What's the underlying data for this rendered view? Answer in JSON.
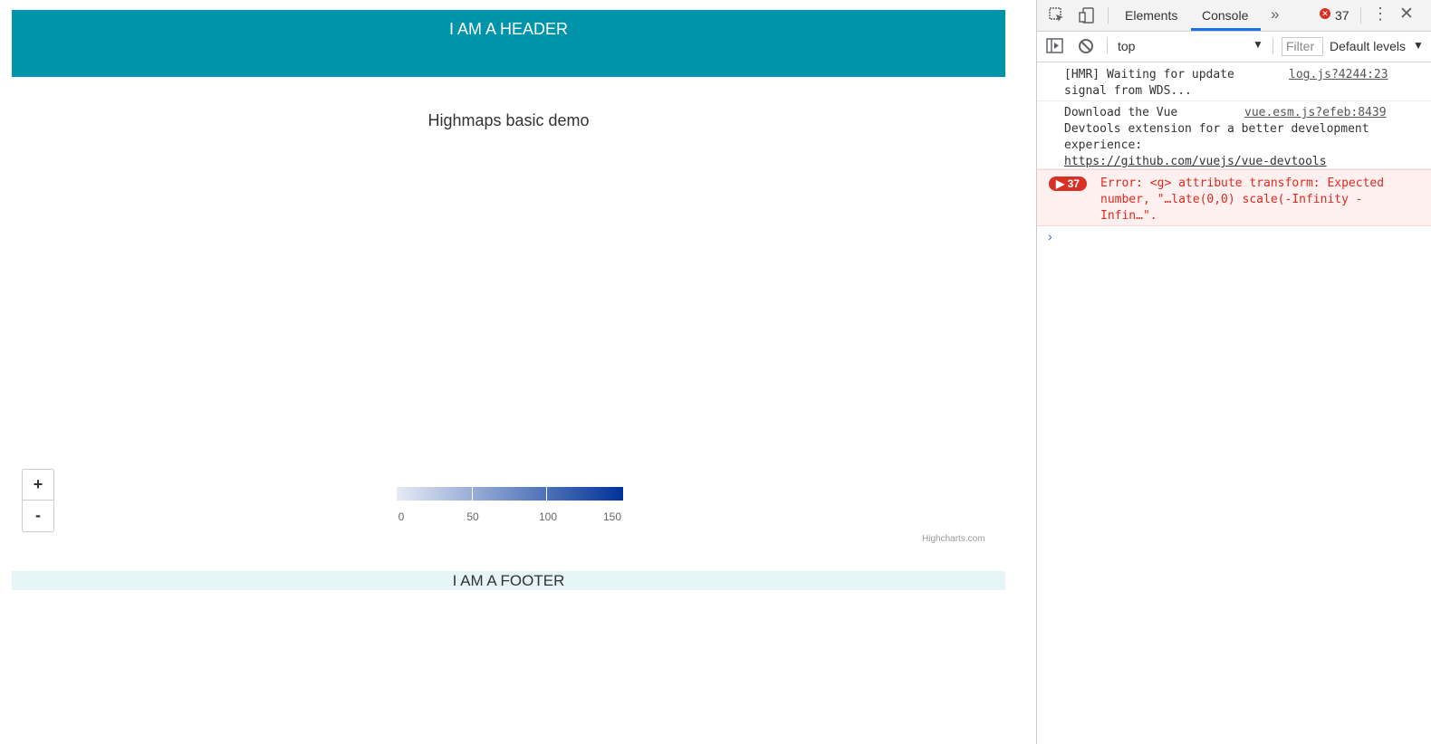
{
  "page": {
    "header_text": "I AM A HEADER",
    "footer_text": "I AM A FOOTER",
    "chart": {
      "title": "Highmaps basic demo",
      "zoom_in_label": "+",
      "zoom_out_label": "-",
      "credits": "Highcharts.com",
      "legend": {
        "labels": [
          "0",
          "50",
          "100",
          "150"
        ],
        "min_color": "#e6ebf5",
        "max_color": "#003399"
      }
    }
  },
  "devtools": {
    "tabs": [
      "Elements",
      "Console"
    ],
    "active_tab": "Console",
    "more_tabs_icon": "double-chevron-right-icon",
    "error_count": "37",
    "context": "top",
    "filter_placeholder": "Filter",
    "levels": "Default levels",
    "messages": [
      {
        "text": "[HMR] Waiting for update\nsignal from WDS...",
        "source": "log.js?4244:23",
        "level": "log"
      },
      {
        "text": "Download the Vue\nDevtools extension for a better development\nexperience:",
        "link": "https://github.com/vuejs/vue-devtools",
        "source": "vue.esm.js?efeb:8439",
        "level": "log"
      },
      {
        "text": "Error: <g> attribute transform: Expected\nnumber, \"…late(0,0) scale(-Infinity -\nInfin…\".",
        "count": "37",
        "level": "error"
      }
    ]
  }
}
